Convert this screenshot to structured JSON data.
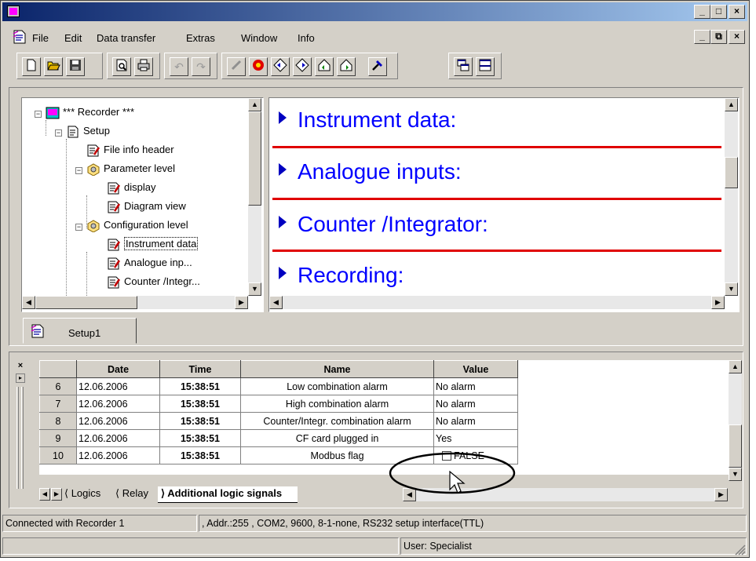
{
  "window": {
    "minimize": "_",
    "restore": "□",
    "close": "×",
    "doc_minimize": "_",
    "doc_restore": "⧉",
    "doc_close": "×"
  },
  "menu": {
    "items": [
      "File",
      "Edit",
      "Data transfer",
      "Extras",
      "Window",
      "Info"
    ]
  },
  "toolbar": {
    "groups": [
      [
        "new-icon",
        "open-icon",
        "save-icon"
      ],
      [
        "print-preview-icon",
        "print-icon"
      ],
      [
        "undo-icon",
        "redo-icon"
      ],
      [
        "modem-icon",
        "connect-icon",
        "transfer-left-icon",
        "transfer-right-icon",
        "upload-icon",
        "download-icon",
        "tools-icon"
      ],
      [
        "tile-icon",
        "split-icon"
      ]
    ]
  },
  "tree": {
    "items": [
      {
        "label": "*** Recorder ***",
        "level": 0,
        "icon": "recorder-icon",
        "expander": "−"
      },
      {
        "label": "Setup",
        "level": 1,
        "icon": "setup-icon",
        "expander": "−"
      },
      {
        "label": "File info header",
        "level": 2,
        "icon": "edit-doc-icon",
        "expander": ""
      },
      {
        "label": "Parameter level",
        "level": 2,
        "icon": "gear-icon",
        "expander": "−"
      },
      {
        "label": "display",
        "level": 3,
        "icon": "edit-doc-icon",
        "expander": ""
      },
      {
        "label": "Diagram view",
        "level": 3,
        "icon": "edit-doc-icon",
        "expander": ""
      },
      {
        "label": "Configuration level",
        "level": 2,
        "icon": "gear-icon",
        "expander": "−"
      },
      {
        "label": "Instrument data",
        "level": 3,
        "icon": "edit-doc-icon",
        "expander": "",
        "selected": true
      },
      {
        "label": "Analogue inp...",
        "level": 3,
        "icon": "edit-doc-icon",
        "expander": ""
      },
      {
        "label": "Counter /Integr...",
        "level": 3,
        "icon": "edit-doc-icon",
        "expander": ""
      }
    ]
  },
  "sections": [
    {
      "label": "Instrument data:"
    },
    {
      "label": "Analogue inputs:"
    },
    {
      "label": "Counter /Integrator:"
    },
    {
      "label": "Recording:"
    }
  ],
  "doc_tab": {
    "label": "Setup1"
  },
  "table": {
    "headers": [
      "Date",
      "Time",
      "Name",
      "Value"
    ],
    "rows": [
      {
        "n": "6",
        "date": "12.06.2006",
        "time": "15:38:51",
        "name": "Low combination alarm",
        "value": "No alarm"
      },
      {
        "n": "7",
        "date": "12.06.2006",
        "time": "15:38:51",
        "name": "High combination alarm",
        "value": "No alarm"
      },
      {
        "n": "8",
        "date": "12.06.2006",
        "time": "15:38:51",
        "name": "Counter/Integr. combination alarm",
        "value": "No alarm"
      },
      {
        "n": "9",
        "date": "12.06.2006",
        "time": "15:38:51",
        "name": "CF card plugged in",
        "value": "Yes"
      },
      {
        "n": "10",
        "date": "12.06.2006",
        "time": "15:38:51",
        "name": "Modbus flag",
        "value": "FALSE"
      }
    ]
  },
  "sheet_tabs": [
    "Logics",
    "Relay",
    "Additional logic signals"
  ],
  "status": {
    "connection": "Connected with Recorder 1",
    "details": ", Addr.:255 , COM2, 9600, 8-1-none, RS232 setup interface(TTL)",
    "user": "User: Specialist"
  },
  "colors": {
    "accent": "#0000ff",
    "separator": "#e00000",
    "titlebar_start": "#0a246a",
    "titlebar_end": "#a6caf0",
    "chrome": "#d4d0c8"
  }
}
